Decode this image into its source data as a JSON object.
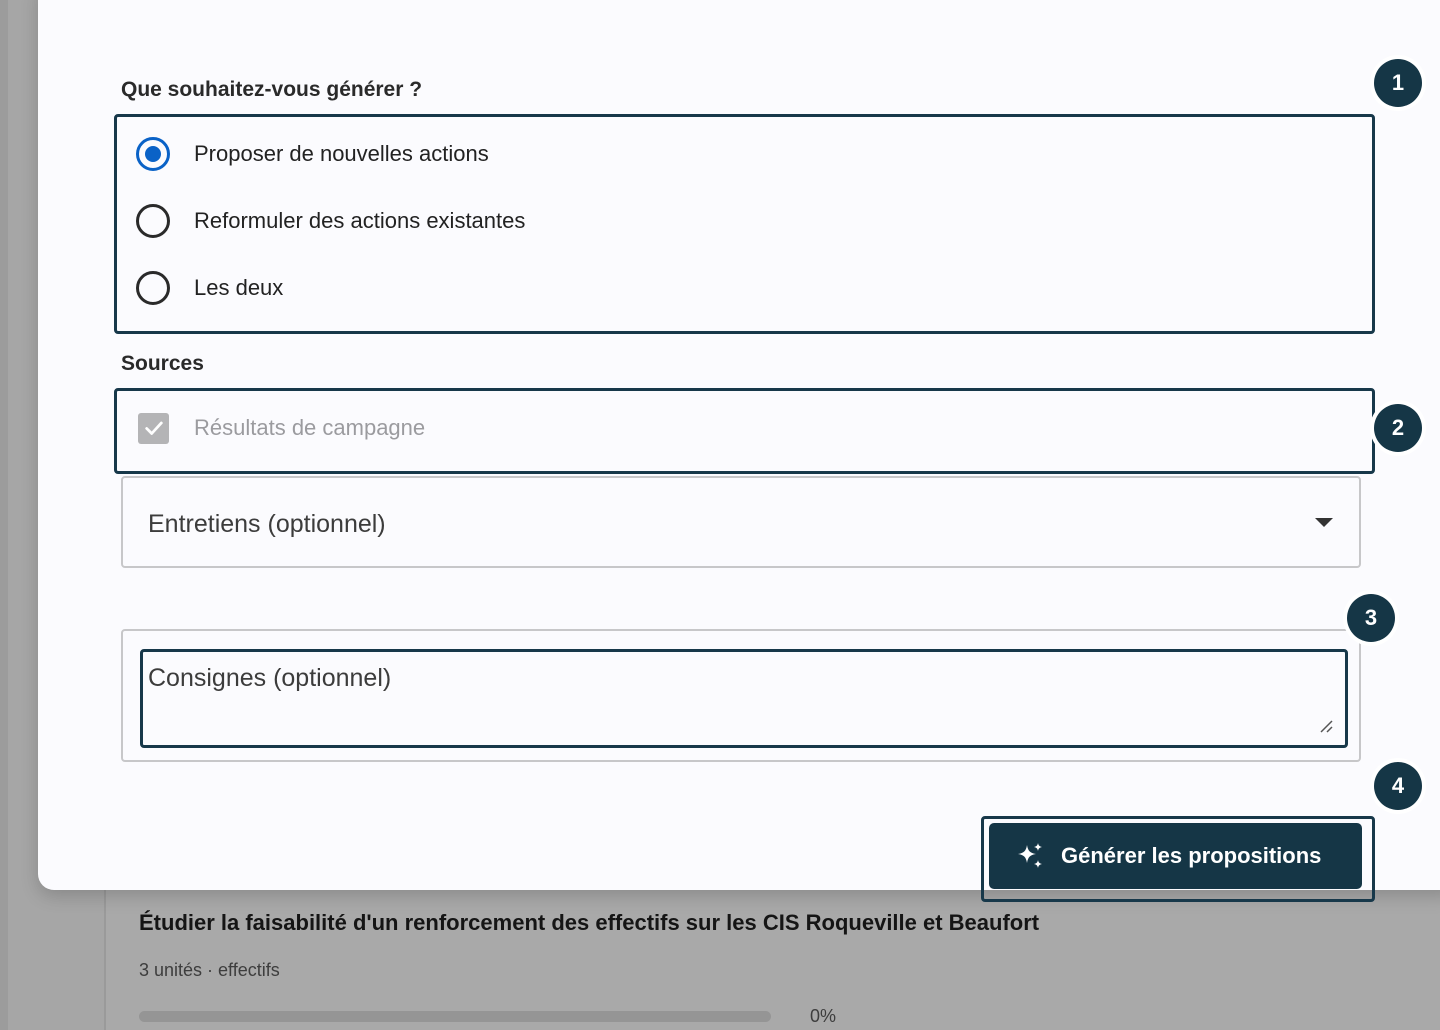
{
  "background": {
    "card_title": "Étudier la faisabilité d'un renforcement des effectifs sur les CIS Roqueville et Beaufort",
    "card_meta": "3 unités · effectifs",
    "progress_label": "0%",
    "progress_value": 0
  },
  "form": {
    "generate_question": "Que souhaitez-vous générer ?",
    "options": [
      {
        "label": "Proposer de nouvelles actions",
        "checked": true
      },
      {
        "label": "Reformuler des actions existantes",
        "checked": false
      },
      {
        "label": "Les deux",
        "checked": false
      }
    ],
    "sources_heading": "Sources",
    "campaign_results_label": "Résultats de campagne",
    "campaign_results_checked": true,
    "interviews_select_label": "Entretiens (optionnel)",
    "instructions_placeholder": "Consignes (optionnel)",
    "generate_button_label": "Générer les propositions"
  },
  "step_badges": [
    "1",
    "2",
    "3",
    "4"
  ],
  "colors": {
    "accent_dark": "#153646",
    "radio_blue": "#0a62c7",
    "modal_bg": "#fbfbfe",
    "overlay_bg": "#a6a6a6"
  },
  "icons": {
    "generate": "sparkles-icon",
    "select": "caret-down-icon",
    "checkbox": "check-icon"
  }
}
